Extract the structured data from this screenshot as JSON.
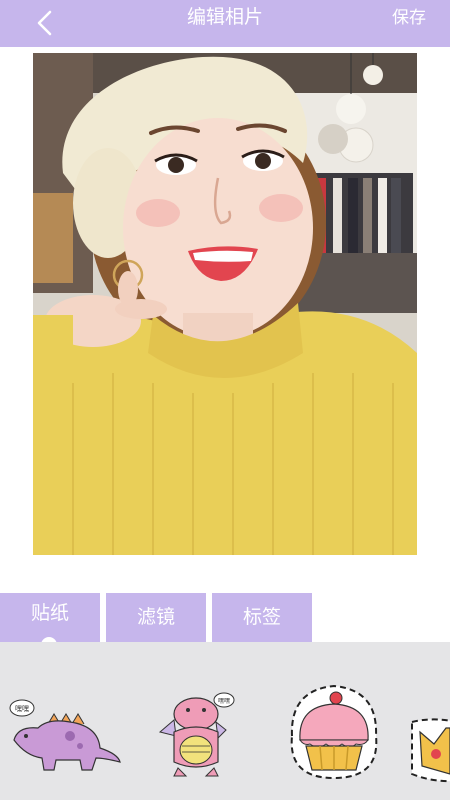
{
  "header": {
    "title": "编辑相片",
    "save_label": "保存",
    "back_icon": "chevron-left-icon"
  },
  "colors": {
    "accent": "#c6b6ec",
    "tray_background": "#e5e5e7",
    "sweater": "#e9cf58"
  },
  "tabs": [
    {
      "label": "贴纸",
      "active": true
    },
    {
      "label": "滤镜",
      "active": false
    },
    {
      "label": "标签",
      "active": false
    }
  ],
  "stickers": [
    {
      "name": "dinosaur",
      "caption": "嘿嘿"
    },
    {
      "name": "dragon",
      "caption": "嘿嘿"
    },
    {
      "name": "cupcake"
    },
    {
      "name": "crown"
    }
  ]
}
